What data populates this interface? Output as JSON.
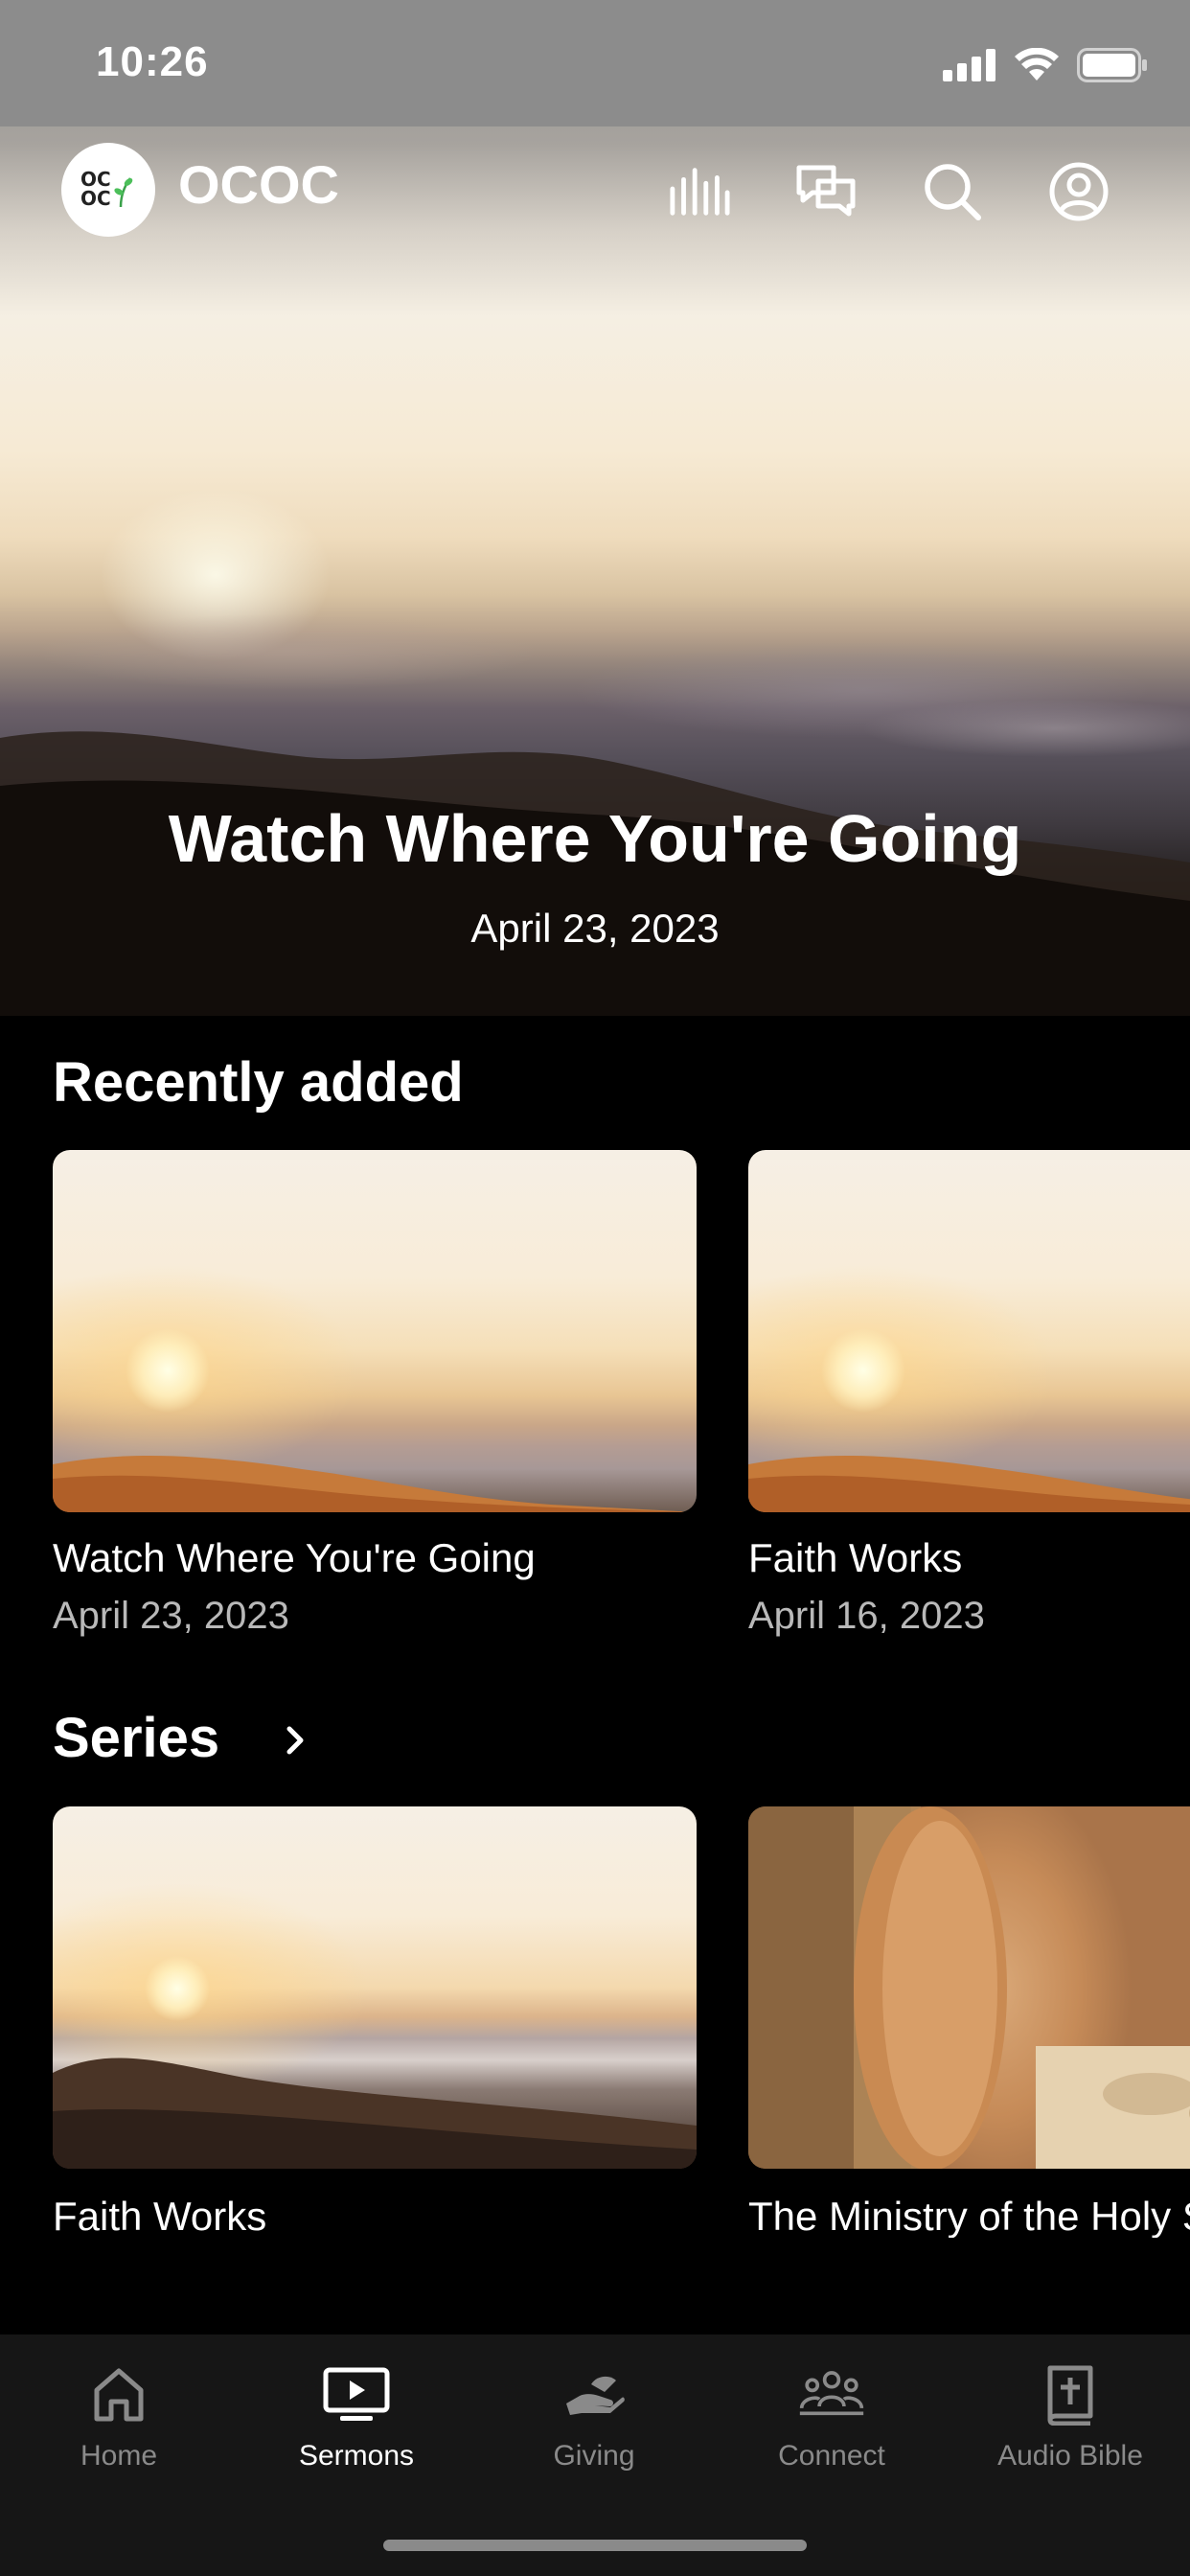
{
  "status_bar": {
    "time": "10:26"
  },
  "header": {
    "app_name": "OCOC",
    "logo_text": "OC OC"
  },
  "hero": {
    "title": "Watch Where You're Going",
    "date": "April 23, 2023"
  },
  "recently_added": {
    "title": "Recently added",
    "items": [
      {
        "title": "Watch Where You're Going",
        "date": "April 23, 2023"
      },
      {
        "title": "Faith Works",
        "date": "April 16, 2023"
      }
    ]
  },
  "series": {
    "title": "Series",
    "items": [
      {
        "title": "Faith Works"
      },
      {
        "title": "The Ministry of the Holy Spirit"
      }
    ]
  },
  "tab_bar": {
    "tabs": [
      {
        "label": "Home",
        "icon": "home-icon"
      },
      {
        "label": "Sermons",
        "icon": "tv-play-icon",
        "active": true
      },
      {
        "label": "Giving",
        "icon": "giving-hand-icon"
      },
      {
        "label": "Connect",
        "icon": "group-icon"
      },
      {
        "label": "Audio Bible",
        "icon": "bible-icon"
      }
    ]
  }
}
